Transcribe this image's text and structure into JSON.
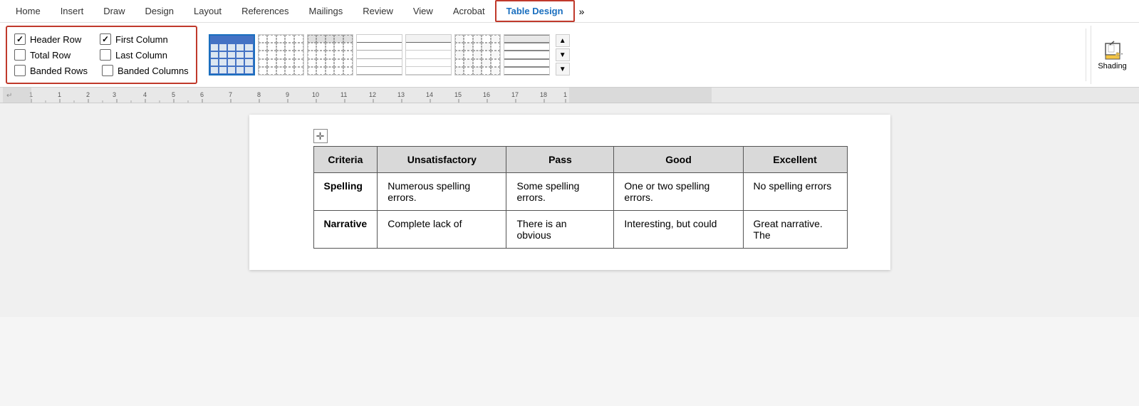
{
  "tabs": {
    "items": [
      {
        "label": "Home",
        "id": "home"
      },
      {
        "label": "Insert",
        "id": "insert"
      },
      {
        "label": "Draw",
        "id": "draw"
      },
      {
        "label": "Design",
        "id": "design"
      },
      {
        "label": "Layout",
        "id": "layout"
      },
      {
        "label": "References",
        "id": "references"
      },
      {
        "label": "Mailings",
        "id": "mailings"
      },
      {
        "label": "Review",
        "id": "review"
      },
      {
        "label": "View",
        "id": "view"
      },
      {
        "label": "Acrobat",
        "id": "acrobat"
      },
      {
        "label": "Table Design",
        "id": "table-design"
      }
    ]
  },
  "style_options": {
    "checkboxes": [
      {
        "label": "Header Row",
        "checked": true,
        "id": "header-row"
      },
      {
        "label": "First Column",
        "checked": true,
        "id": "first-column"
      },
      {
        "label": "Total Row",
        "checked": false,
        "id": "total-row"
      },
      {
        "label": "Last Column",
        "checked": false,
        "id": "last-column"
      },
      {
        "label": "Banded Rows",
        "checked": false,
        "id": "banded-rows"
      },
      {
        "label": "Banded Columns",
        "checked": false,
        "id": "banded-columns"
      }
    ]
  },
  "gallery": {
    "more_label": ">",
    "nav_up": "▲",
    "nav_down": "▼",
    "nav_more": "▼"
  },
  "shading": {
    "label": "Shading"
  },
  "ruler": {
    "marks": [
      "-",
      "1",
      "1",
      "2",
      "3",
      "4",
      "5",
      "6",
      "7",
      "8",
      "9",
      "10",
      "11",
      "12",
      "13",
      "14",
      "15",
      "16",
      "17",
      "18"
    ]
  },
  "document": {
    "move_handle": "✛",
    "table": {
      "headers": [
        "Criteria",
        "Unsatisfactory",
        "Pass",
        "Good",
        "Excellent"
      ],
      "rows": [
        {
          "criteria": "Spelling",
          "unsatisfactory": "Numerous spelling errors.",
          "pass": "Some spelling errors.",
          "good": "One or two spelling errors.",
          "excellent": "No spelling errors"
        },
        {
          "criteria": "Narrative",
          "unsatisfactory": "Complete lack of",
          "pass": "There is an obvious",
          "good": "Interesting, but could",
          "excellent": "Great narrative. The"
        }
      ]
    }
  }
}
